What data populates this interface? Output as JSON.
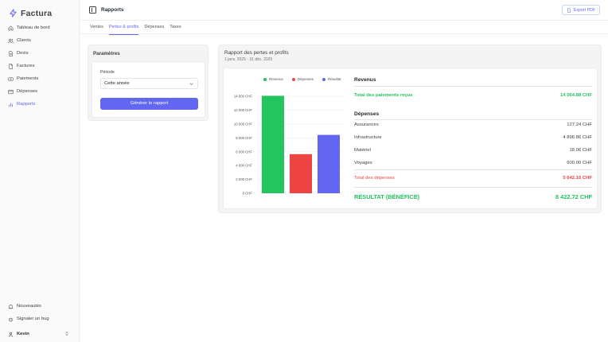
{
  "app": {
    "name": "Factura",
    "brand_color": "#6366f1"
  },
  "sidebar": {
    "items": [
      {
        "label": "Tableau de bord",
        "icon": "home-icon",
        "active": false
      },
      {
        "label": "Clients",
        "icon": "users-icon",
        "active": false
      },
      {
        "label": "Devis",
        "icon": "document-icon",
        "active": false
      },
      {
        "label": "Factures",
        "icon": "file-icon",
        "active": false
      },
      {
        "label": "Paiements",
        "icon": "payment-icon",
        "active": false
      },
      {
        "label": "Dépenses",
        "icon": "wallet-icon",
        "active": false
      },
      {
        "label": "Rapports",
        "icon": "bar-chart-icon",
        "active": true
      }
    ],
    "bottom": [
      {
        "label": "Nouveautés",
        "icon": "bell-icon"
      },
      {
        "label": "Signaler un bug",
        "icon": "bug-icon"
      }
    ],
    "user": {
      "name": "Kevin"
    }
  },
  "header": {
    "title": "Rapports",
    "export_label": "Export PDF"
  },
  "tabs": [
    {
      "label": "Ventes",
      "active": false
    },
    {
      "label": "Pertes & profits",
      "active": true
    },
    {
      "label": "Dépenses",
      "active": false
    },
    {
      "label": "Taxes",
      "active": false
    }
  ],
  "params": {
    "title": "Paramètres",
    "period_label": "Période",
    "period_value": "Cette année",
    "generate_label": "Générer le rapport"
  },
  "report": {
    "title": "Rapport des pertes et profits",
    "date_range": "1 janv. 2025 - 31 déc. 2025",
    "revenue": {
      "heading": "Revenus",
      "total_label": "Total des paiements reçus",
      "total_value": "14 064.88 CHF"
    },
    "expenses": {
      "heading": "Dépenses",
      "rows": [
        {
          "label": "Assurances",
          "value": "127.24 CHF"
        },
        {
          "label": "Infrastructure",
          "value": "4 896.86 CHF"
        },
        {
          "label": "Matériel",
          "value": "18.06 CHF"
        },
        {
          "label": "Voyages",
          "value": "600.00 CHF"
        }
      ],
      "total_label": "Total des dépenses",
      "total_value": "5 642.16 CHF"
    },
    "result": {
      "label": "RÉSULTAT (BÉNÉFICE)",
      "value": "8 422.72 CHF"
    }
  },
  "chart_data": {
    "type": "bar",
    "categories": [
      "Revenus",
      "Dépenses",
      "Résultat"
    ],
    "values": [
      14064.88,
      5642.16,
      8422.72
    ],
    "colors": [
      "#22c55e",
      "#ef4444",
      "#6366f1"
    ],
    "legend": [
      "Revenus",
      "Dépenses",
      "Résultat"
    ],
    "legend_position": "top",
    "y_ticks": [
      "0 CHF",
      "2 000 CHF",
      "4 000 CHF",
      "6 000 CHF",
      "8 000 CHF",
      "10 000 CHF",
      "12 000 CHF",
      "14 000 CHF"
    ],
    "ylim": [
      0,
      14000
    ],
    "grid": true
  }
}
